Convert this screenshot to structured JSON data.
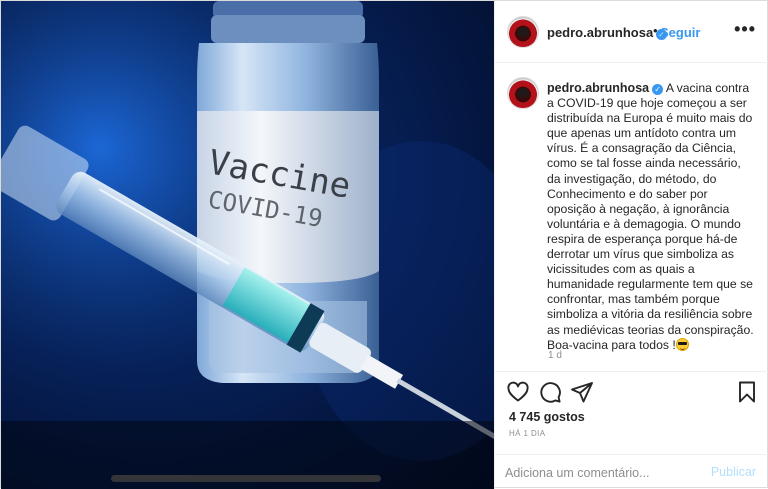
{
  "media": {
    "vial_word_1": "Vaccine",
    "vial_word_2": "COVID-19"
  },
  "header": {
    "username": "pedro.abrunhosa",
    "separator": "•",
    "follow_label": "Seguir",
    "more_label": "•••"
  },
  "caption": {
    "username": "pedro.abrunhosa",
    "text": "A vacina contra a COVID-19 que hoje começou a ser distribuída na Europa é muito mais do que apenas um antídoto contra um vírus. É a consagração da Ciência, como se tal fosse ainda necessário, da investigação, do método, do Conhecimento e do saber por oposição à negação, à ignorância voluntária e à demagogia. O mundo respira de esperança porque há-de derrotar um vírus que simboliza as vicissitudes com as quais a humanidade regularmente tem que se confrontar, mas também porque simboliza a vitória da resiliência sobre as mediévicas teorias da conspiração. Boa-vacina para todos !",
    "time": "1 d"
  },
  "actions": {
    "likes": "4 745 gostos",
    "time_ago": "HÁ 1 DIA"
  },
  "comment": {
    "placeholder": "Adiciona um comentário...",
    "publish_label": "Publicar"
  },
  "icons": {
    "verified": "verified-badge-icon",
    "like": "heart-icon",
    "comment": "comment-bubble-icon",
    "share": "paper-plane-icon",
    "save": "bookmark-icon",
    "emoji": "sunglasses-emoji-icon"
  },
  "colors": {
    "link_blue": "#3897f0",
    "publish_disabled": "#b2dffc",
    "muted_text": "#8e8e8e",
    "border": "#dbdbdb"
  }
}
